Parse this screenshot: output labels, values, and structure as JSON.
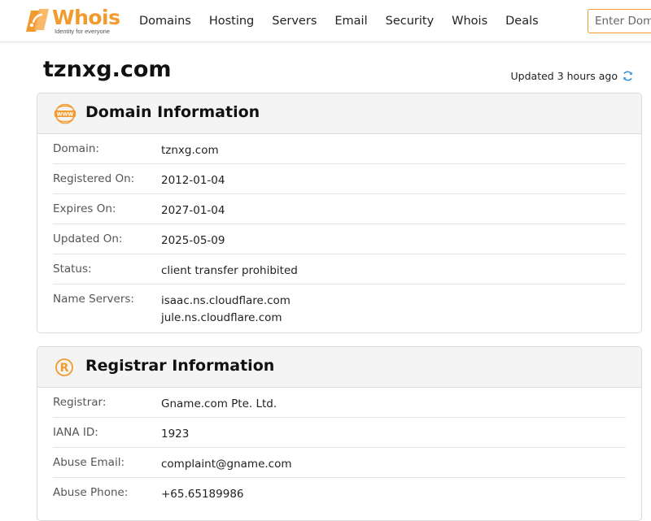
{
  "brand": {
    "name": "Whois",
    "tagline": "Identity for everyone",
    "color": "#f29a2e"
  },
  "nav": {
    "items": [
      "Domains",
      "Hosting",
      "Servers",
      "Email",
      "Security",
      "Whois",
      "Deals"
    ]
  },
  "search": {
    "placeholder": "Enter Domain or IP"
  },
  "page": {
    "title": "tznxg.com",
    "updated": "Updated 3 hours ago"
  },
  "domain_info": {
    "title": "Domain Information",
    "icon": "www-icon",
    "rows": [
      {
        "label": "Domain:",
        "values": [
          "tznxg.com"
        ]
      },
      {
        "label": "Registered On:",
        "values": [
          "2012-01-04"
        ]
      },
      {
        "label": "Expires On:",
        "values": [
          "2027-01-04"
        ]
      },
      {
        "label": "Updated On:",
        "values": [
          "2025-05-09"
        ]
      },
      {
        "label": "Status:",
        "values": [
          "client transfer prohibited"
        ]
      },
      {
        "label": "Name Servers:",
        "values": [
          "isaac.ns.cloudflare.com",
          "jule.ns.cloudflare.com"
        ]
      }
    ]
  },
  "registrar_info": {
    "title": "Registrar Information",
    "icon": "registered-icon",
    "rows": [
      {
        "label": "Registrar:",
        "values": [
          "Gname.com Pte. Ltd."
        ]
      },
      {
        "label": "IANA ID:",
        "values": [
          "1923"
        ]
      },
      {
        "label": "Abuse Email:",
        "values": [
          "complaint@gname.com"
        ]
      },
      {
        "label": "Abuse Phone:",
        "values": [
          "+65.65189986"
        ]
      }
    ]
  }
}
